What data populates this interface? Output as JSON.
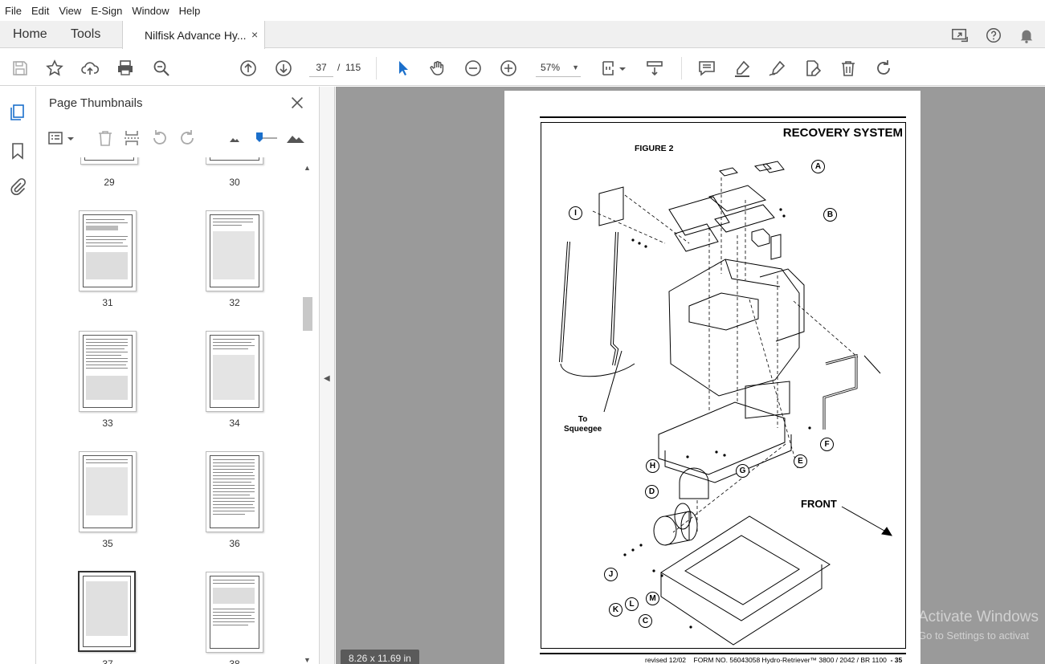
{
  "menu": [
    "File",
    "Edit",
    "View",
    "E-Sign",
    "Window",
    "Help"
  ],
  "tabs": {
    "home": "Home",
    "tools": "Tools",
    "document_title": "Nilfisk Advance Hy...",
    "close": "×"
  },
  "toolbar": {
    "current_page": "37",
    "page_sep": "/",
    "total_pages": "115",
    "zoom": "57%"
  },
  "thumbnails_panel": {
    "title": "Page Thumbnails",
    "close": "✕",
    "labels": [
      "29",
      "30",
      "31",
      "32",
      "33",
      "34",
      "35",
      "36",
      "37",
      "38"
    ],
    "selected": "37"
  },
  "document": {
    "heading": "RECOVERY SYSTEM",
    "figure_label": "FIGURE 2",
    "front_label": "FRONT",
    "squeegee_line1": "To",
    "squeegee_line2": "Squeegee",
    "callouts": [
      "A",
      "B",
      "I",
      "F",
      "E",
      "H",
      "G",
      "D",
      "J",
      "K",
      "L",
      "M",
      "C"
    ],
    "footer_revised": "revised 12/02",
    "footer_form": "FORM NO. 56043058 Hydro-Retriever™ 3800 / 2042 / BR 1100",
    "footer_page": "- 35",
    "page_size": "8.26 x 11.69 in"
  },
  "watermark": {
    "line1": "Activate Windows",
    "line2": "Go to Settings to activat"
  },
  "colors": {
    "accent_blue": "#1a6fcb",
    "doc_background": "#9a9a9a"
  }
}
